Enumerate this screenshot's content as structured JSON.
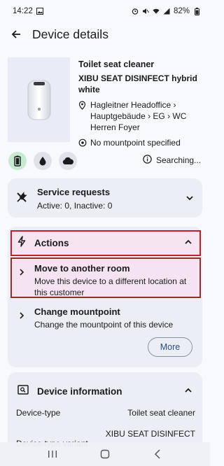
{
  "status_bar": {
    "time": "14:22",
    "battery": "82%"
  },
  "app_bar": {
    "title": "Device details"
  },
  "device": {
    "type": "Toilet seat cleaner",
    "name": "XIBU SEAT DISINFECT hybrid white",
    "location": "Hagleitner Headoffice › Hauptgebäude › EG › WC Herren Foyer",
    "mountpoint": "No mountpoint specified"
  },
  "badges": [
    "battery-icon",
    "drop-icon",
    "cloud-icon"
  ],
  "connection": {
    "status": "Searching..."
  },
  "service_requests": {
    "title": "Service requests",
    "counts": "Active: 0, Inactive: 0"
  },
  "actions": {
    "title": "Actions",
    "items": [
      {
        "title": "Move to another room",
        "subtitle": "Move this device to a different location at this customer"
      },
      {
        "title": "Change mountpoint",
        "subtitle": "Change the mountpoint of this device"
      }
    ],
    "more_label": "More"
  },
  "device_information": {
    "title": "Device information",
    "rows": [
      {
        "label": "Device-type",
        "value": "Toilet seat cleaner"
      },
      {
        "label": "Device-type variant",
        "value": "XIBU SEAT DISINFECT"
      }
    ]
  },
  "colors": {
    "highlight_border": "#c01f2f",
    "card_bg": "#eceef6",
    "accent": "#2a4b8d"
  }
}
